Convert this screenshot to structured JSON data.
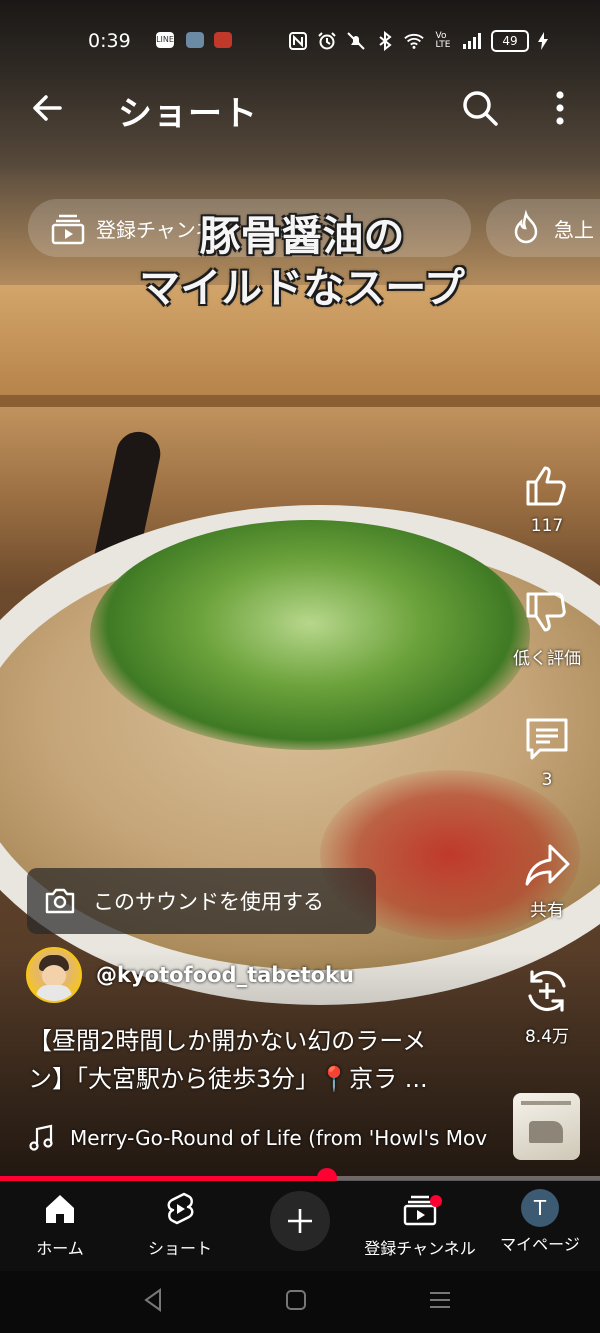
{
  "status_bar": {
    "time": "0:39",
    "apps": [
      "LINE",
      "photos",
      "shop"
    ],
    "battery": "49"
  },
  "header": {
    "title": "ショート"
  },
  "chips": [
    {
      "label": "登録チャンネル・ライブ",
      "icon": "subscriptions-icon"
    },
    {
      "label": "急上",
      "icon": "trending-icon"
    }
  ],
  "overlay_caption": {
    "line1": "豚骨醤油の",
    "line2": "マイルドなスープ"
  },
  "actions": {
    "like_count": "117",
    "dislike_label": "低く評価",
    "comment_count": "3",
    "share_label": "共有",
    "remix_count": "8.4万"
  },
  "use_sound_label": "このサウンドを使用する",
  "channel": {
    "handle": "@kyotofood_tabetoku"
  },
  "video": {
    "title_line1": "【昼間2時間しか開かない幻のラーメ",
    "title_line2": "ン】「大宮駅から徒歩3分」📍京ラ ..."
  },
  "music": {
    "track": "Merry-Go-Round of Life (from 'Howl's Mov"
  },
  "progress": {
    "played_percent": 54.5
  },
  "bottom_nav": {
    "home": "ホーム",
    "shorts": "ショート",
    "subscriptions": "登録チャンネル",
    "you": "マイページ",
    "you_initial": "T"
  },
  "colors": {
    "accent": "#ff0033",
    "nav_bg": "#0f0f0f"
  }
}
